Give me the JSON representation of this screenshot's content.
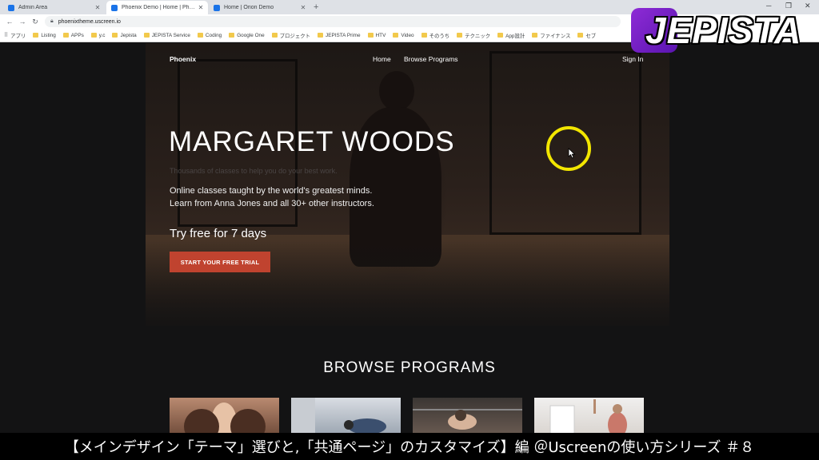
{
  "browser": {
    "tabs": [
      {
        "label": "Admin Area"
      },
      {
        "label": "Phoenix Demo | Home | Phoenix"
      },
      {
        "label": "Home | Orion Demo"
      }
    ],
    "new_tab": "+",
    "url": "phoenixtheme.uscreen.io",
    "bookmarks": [
      "アプリ",
      "Listing",
      "APPs",
      "y.c",
      "Jepista",
      "JEPISTA Service",
      "Coding",
      "Google One",
      "プロジェクト",
      "JEPISTA Prime",
      "HTV",
      "Video",
      "そのうち",
      "テクニック",
      "App設計",
      "ファイナンス",
      "セブ"
    ]
  },
  "site": {
    "brand": "Phoenix",
    "nav": {
      "home": "Home",
      "browse": "Browse Programs",
      "signin": "Sign In"
    },
    "hero": {
      "title": "MARGARET WOODS",
      "tagline": "Thousands of classes to help you do your best work.",
      "line1": "Online classes taught by the world's greatest minds.",
      "line2": "Learn from Anna Jones and all 30+ other instructors.",
      "trial_heading": "Try free for 7 days",
      "cta": "START YOUR FREE TRIAL"
    },
    "browse_title": "BROWSE PROGRAMS"
  },
  "overlay": {
    "logo": "JEPISTA",
    "caption": "【メインデザイン「テーマ」選びと,「共通ページ」のカスタマイズ】編 ＠Uscreenの使い方シリーズ ＃８"
  },
  "colors": {
    "accent": "#c0432f",
    "highlight_ring": "#f2e600",
    "logo_purple": "#8e2bd6"
  }
}
